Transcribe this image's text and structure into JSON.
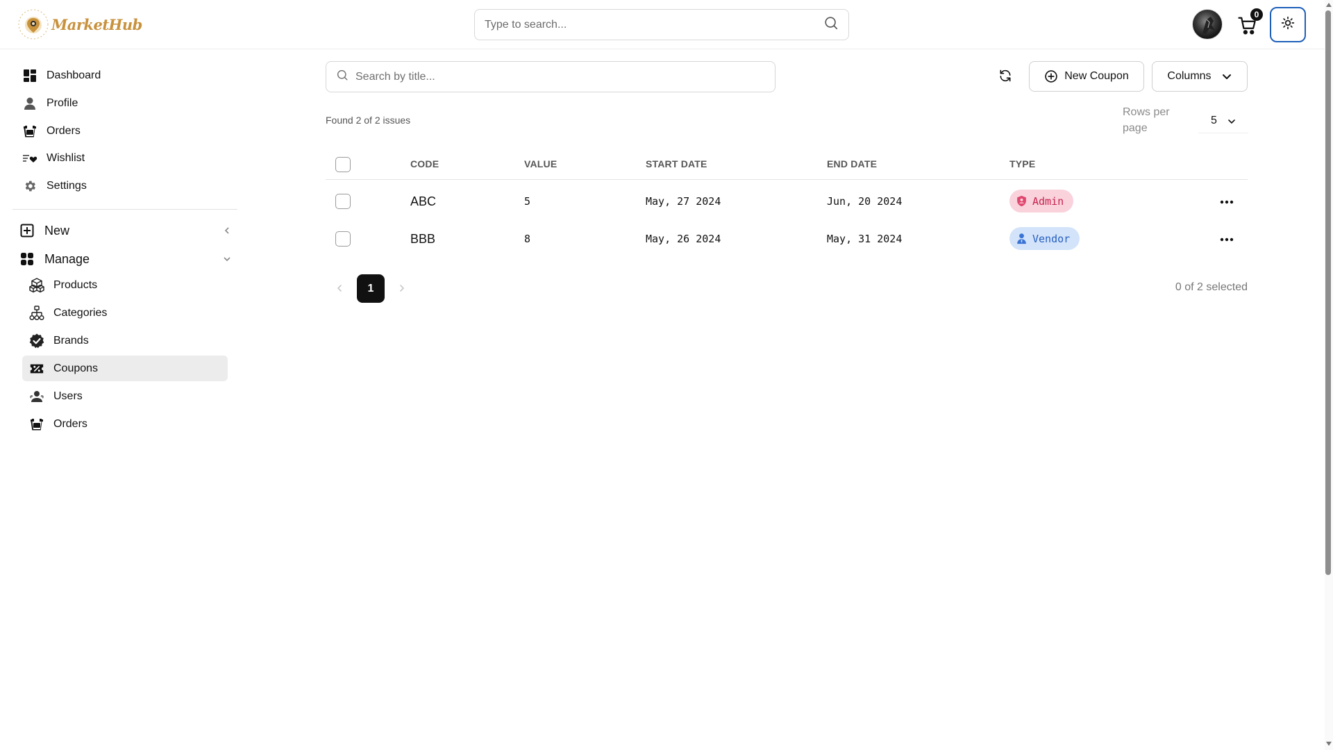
{
  "brand": {
    "name": "MarketHub",
    "accent": "#c8913c"
  },
  "header": {
    "search_placeholder": "Type to search...",
    "cart_count": "0",
    "theme_toggle_border": "#1d5fb8"
  },
  "sidebar": {
    "items": [
      {
        "label": "Dashboard",
        "icon": "dashboard-icon"
      },
      {
        "label": "Profile",
        "icon": "user-icon"
      },
      {
        "label": "Orders",
        "icon": "basket-icon"
      },
      {
        "label": "Wishlist",
        "icon": "heart-list-icon"
      },
      {
        "label": "Settings",
        "icon": "gear-icon"
      }
    ],
    "groups": [
      {
        "label": "New",
        "icon": "plus-square-icon",
        "state": "collapsed"
      },
      {
        "label": "Manage",
        "icon": "grid-icon",
        "state": "expanded"
      }
    ],
    "manage_items": [
      {
        "label": "Products",
        "icon": "boxes-icon"
      },
      {
        "label": "Categories",
        "icon": "hierarchy-icon"
      },
      {
        "label": "Brands",
        "icon": "badge-check-icon"
      },
      {
        "label": "Coupons",
        "icon": "ticket-percent-icon",
        "active": true
      },
      {
        "label": "Users",
        "icon": "users-icon"
      },
      {
        "label": "Orders",
        "icon": "basket-icon"
      }
    ]
  },
  "toolbar": {
    "search_placeholder": "Search by title...",
    "new_coupon_label": "New Coupon",
    "columns_label": "Columns"
  },
  "summary": {
    "found_text": "Found 2 of 2 issues",
    "rows_per_page_label": "Rows per page",
    "rows_per_page_value": "5"
  },
  "table": {
    "columns": [
      "CODE",
      "VALUE",
      "START DATE",
      "END DATE",
      "TYPE"
    ],
    "rows": [
      {
        "code": "ABC",
        "value": "5",
        "start_date": "May, 27 2024",
        "end_date": "Jun, 20 2024",
        "type": "Admin"
      },
      {
        "code": "BBB",
        "value": "8",
        "start_date": "May, 26 2024",
        "end_date": "May, 31 2024",
        "type": "Vendor"
      }
    ]
  },
  "pagination": {
    "current_page": "1",
    "selected_text": "0 of 2 selected"
  },
  "colors": {
    "admin_badge_bg": "#f9d2dc",
    "admin_badge_text": "#c8234e",
    "vendor_badge_bg": "#d3e3fa",
    "vendor_badge_text": "#2660c0"
  }
}
